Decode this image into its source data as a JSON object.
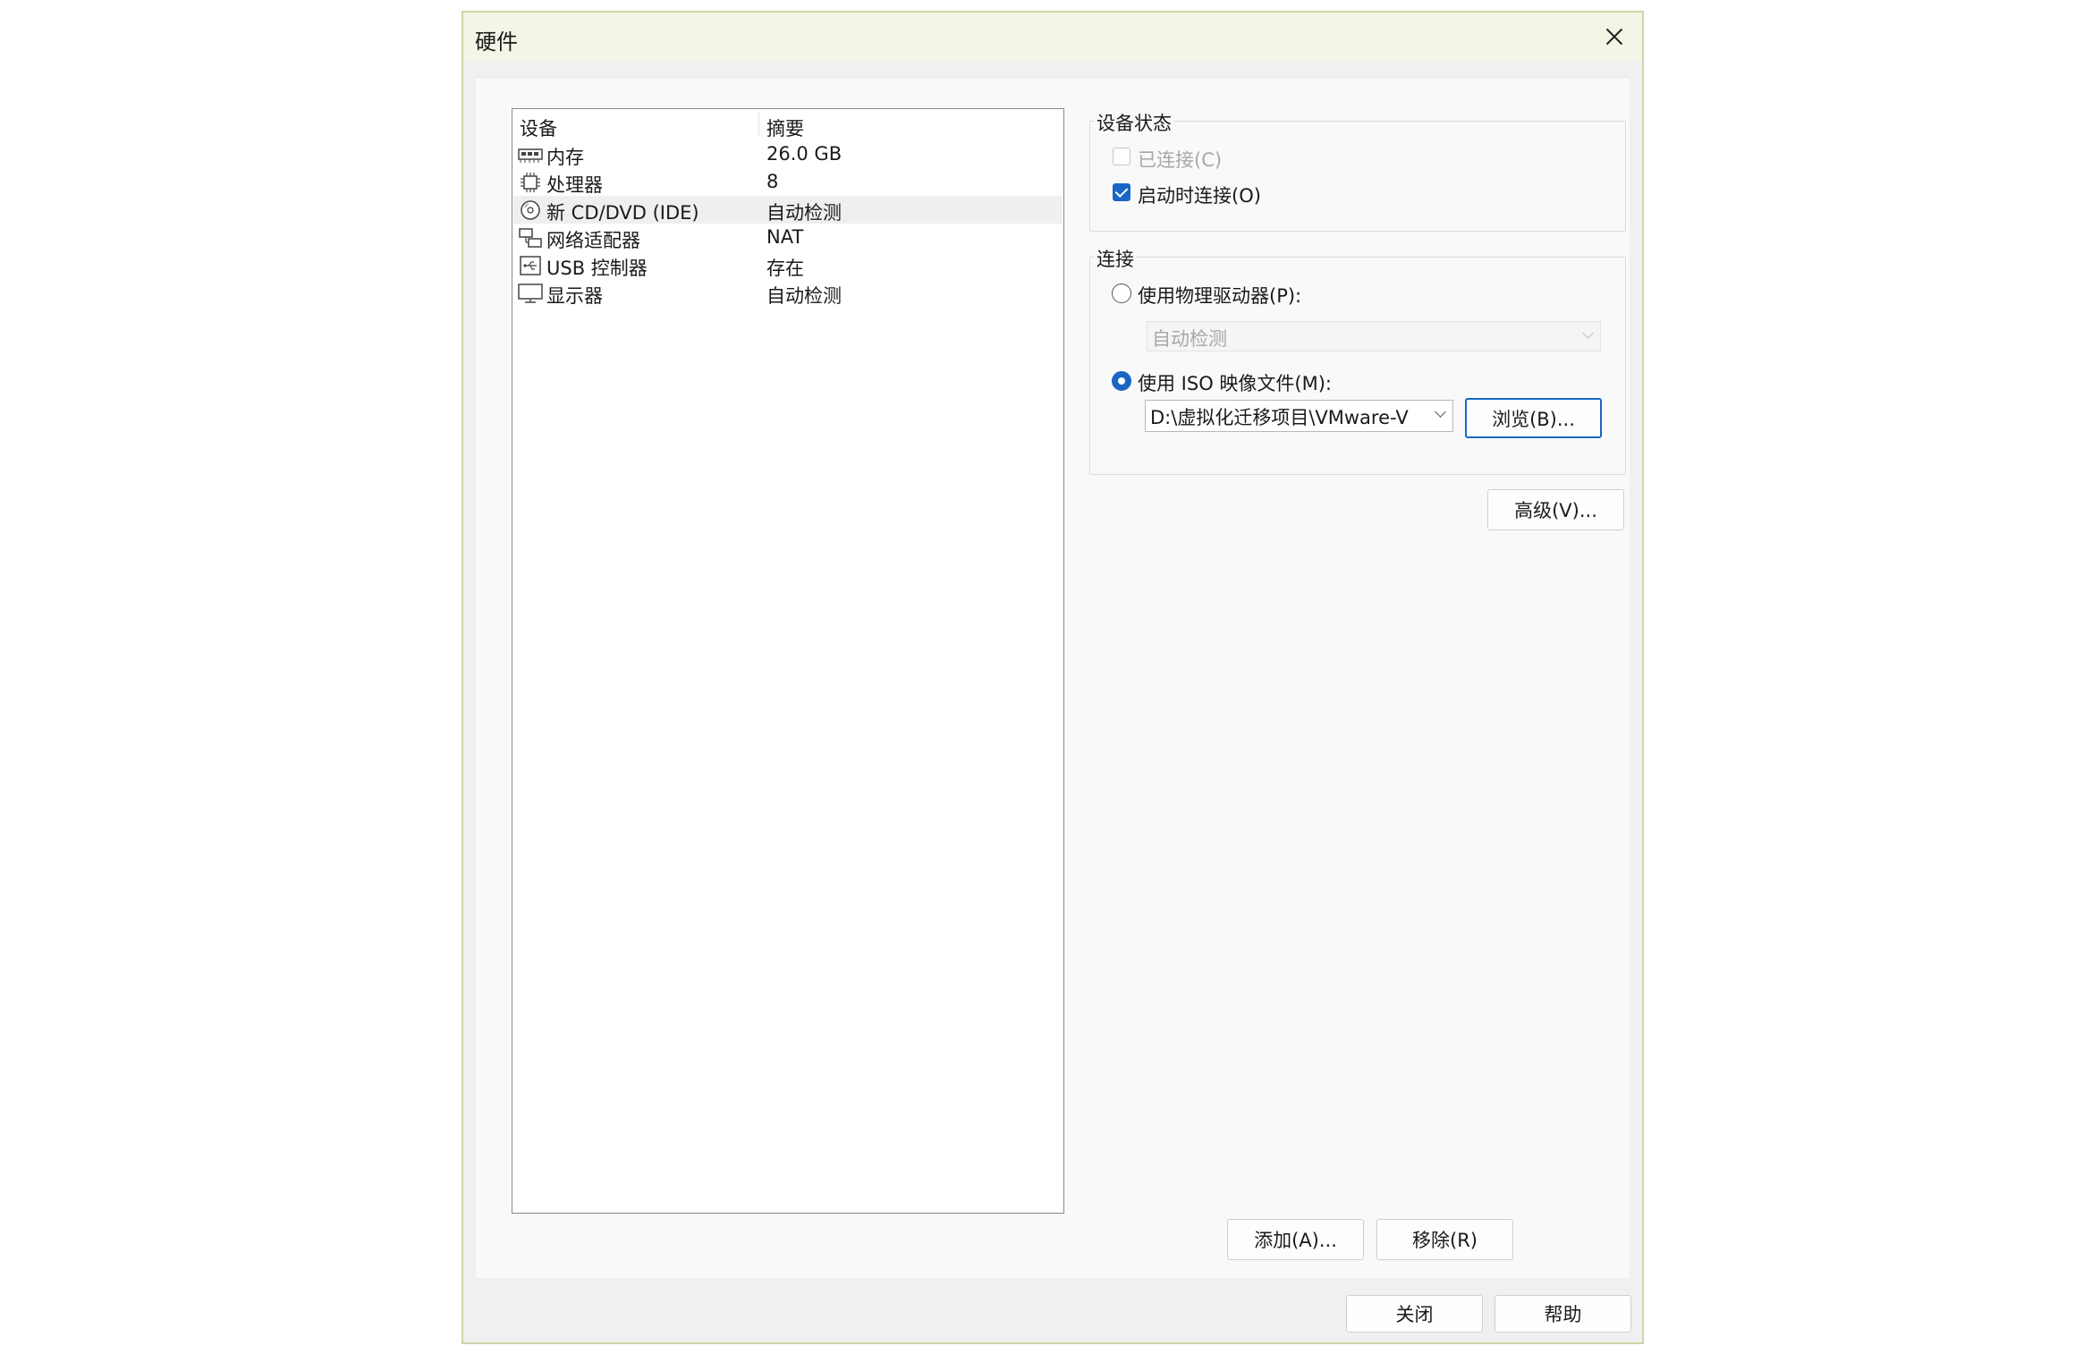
{
  "dialog": {
    "title": "硬件"
  },
  "device_list": {
    "columns": [
      "设备",
      "摘要"
    ],
    "rows": [
      {
        "icon": "memory-icon",
        "device": "内存",
        "summary": "26.0 GB",
        "selected": false
      },
      {
        "icon": "processor-icon",
        "device": "处理器",
        "summary": "8",
        "selected": false
      },
      {
        "icon": "cd-dvd-icon",
        "device": "新 CD/DVD (IDE)",
        "summary": "自动检测",
        "selected": true
      },
      {
        "icon": "network-adapter-icon",
        "device": "网络适配器",
        "summary": "NAT",
        "selected": false
      },
      {
        "icon": "usb-icon",
        "device": "USB 控制器",
        "summary": "存在",
        "selected": false
      },
      {
        "icon": "display-icon",
        "device": "显示器",
        "summary": "自动检测",
        "selected": false
      }
    ]
  },
  "device_status": {
    "label": "设备状态",
    "connected": {
      "label": "已连接(C)",
      "checked": false,
      "enabled": false
    },
    "connect_on_start": {
      "label": "启动时连接(O)",
      "checked": true,
      "enabled": true
    }
  },
  "connection": {
    "label": "连接",
    "physical_drive": {
      "label": "使用物理驱动器(P):",
      "selected": false
    },
    "physical_drive_select": {
      "value": "自动检测",
      "enabled": false
    },
    "iso_image": {
      "label": "使用 ISO 映像文件(M):",
      "selected": true
    },
    "iso_path": {
      "value": "D:\\虚拟化迁移项目\\VMware-V"
    },
    "browse_label": "浏览(B)..."
  },
  "buttons": {
    "advanced": "高级(V)...",
    "add": "添加(A)...",
    "remove": "移除(R)",
    "close": "关闭",
    "help": "帮助"
  }
}
